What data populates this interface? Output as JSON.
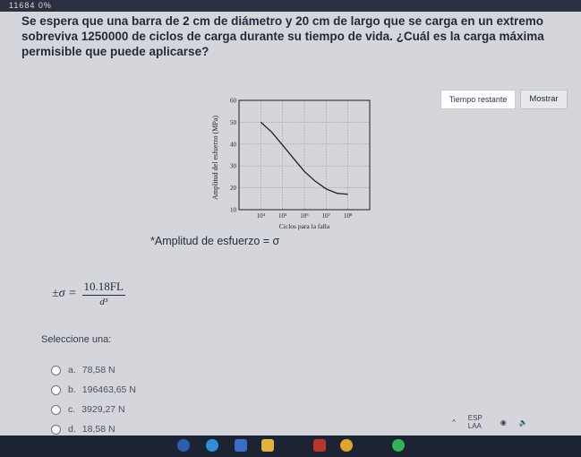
{
  "topbar": {
    "text": "11684 0%"
  },
  "question": {
    "text": "Se espera que una barra de 2 cm de diámetro y 20 cm de largo que se carga en un extremo sobreviva 1250000 de ciclos de carga durante su tiempo de vida. ¿Cuál es la carga máxima permisible que puede aplicarse?"
  },
  "timer": {
    "label": "Tiempo restante"
  },
  "show_button": {
    "label": "Mostrar"
  },
  "chart_data": {
    "type": "line",
    "ylabel": "Amplitud del esfuerzo (MPa)",
    "xlabel": "Ciclos para la falla",
    "x_scale": "log",
    "xlim": [
      1000,
      1000000000
    ],
    "ylim": [
      10,
      60
    ],
    "y_ticks": [
      "10",
      "20",
      "30",
      "40",
      "50",
      "60"
    ],
    "x_ticks": [
      "10⁴",
      "10⁵",
      "10⁶",
      "10⁷",
      "10⁸"
    ],
    "series": [
      {
        "x": [
          10000,
          31623,
          100000,
          316228,
          1000000,
          3162278,
          10000000,
          31622777,
          100000000
        ],
        "y": [
          50,
          45.5,
          39.5,
          33.5,
          27.5,
          23,
          19.5,
          17.5,
          17
        ]
      }
    ],
    "grid": true
  },
  "stress_note": {
    "text": "*Amplitud de esfuerzo = σ"
  },
  "formula": {
    "lhs": "±σ =",
    "numerator": "10.18FL",
    "denominator": "d³"
  },
  "answer": {
    "prompt": "Seleccione una:",
    "options": [
      {
        "letter": "a.",
        "text": "78,58 N"
      },
      {
        "letter": "b.",
        "text": "196463,65 N"
      },
      {
        "letter": "c.",
        "text": "3929,27 N"
      },
      {
        "letter": "d.",
        "text": "18,58 N"
      }
    ]
  },
  "tray": {
    "lang": "ESP LAA",
    "chevron": "^"
  },
  "colors": {
    "taskbar": "#1c2333",
    "page": "#d4d6db",
    "curve": "#1d1f24"
  }
}
